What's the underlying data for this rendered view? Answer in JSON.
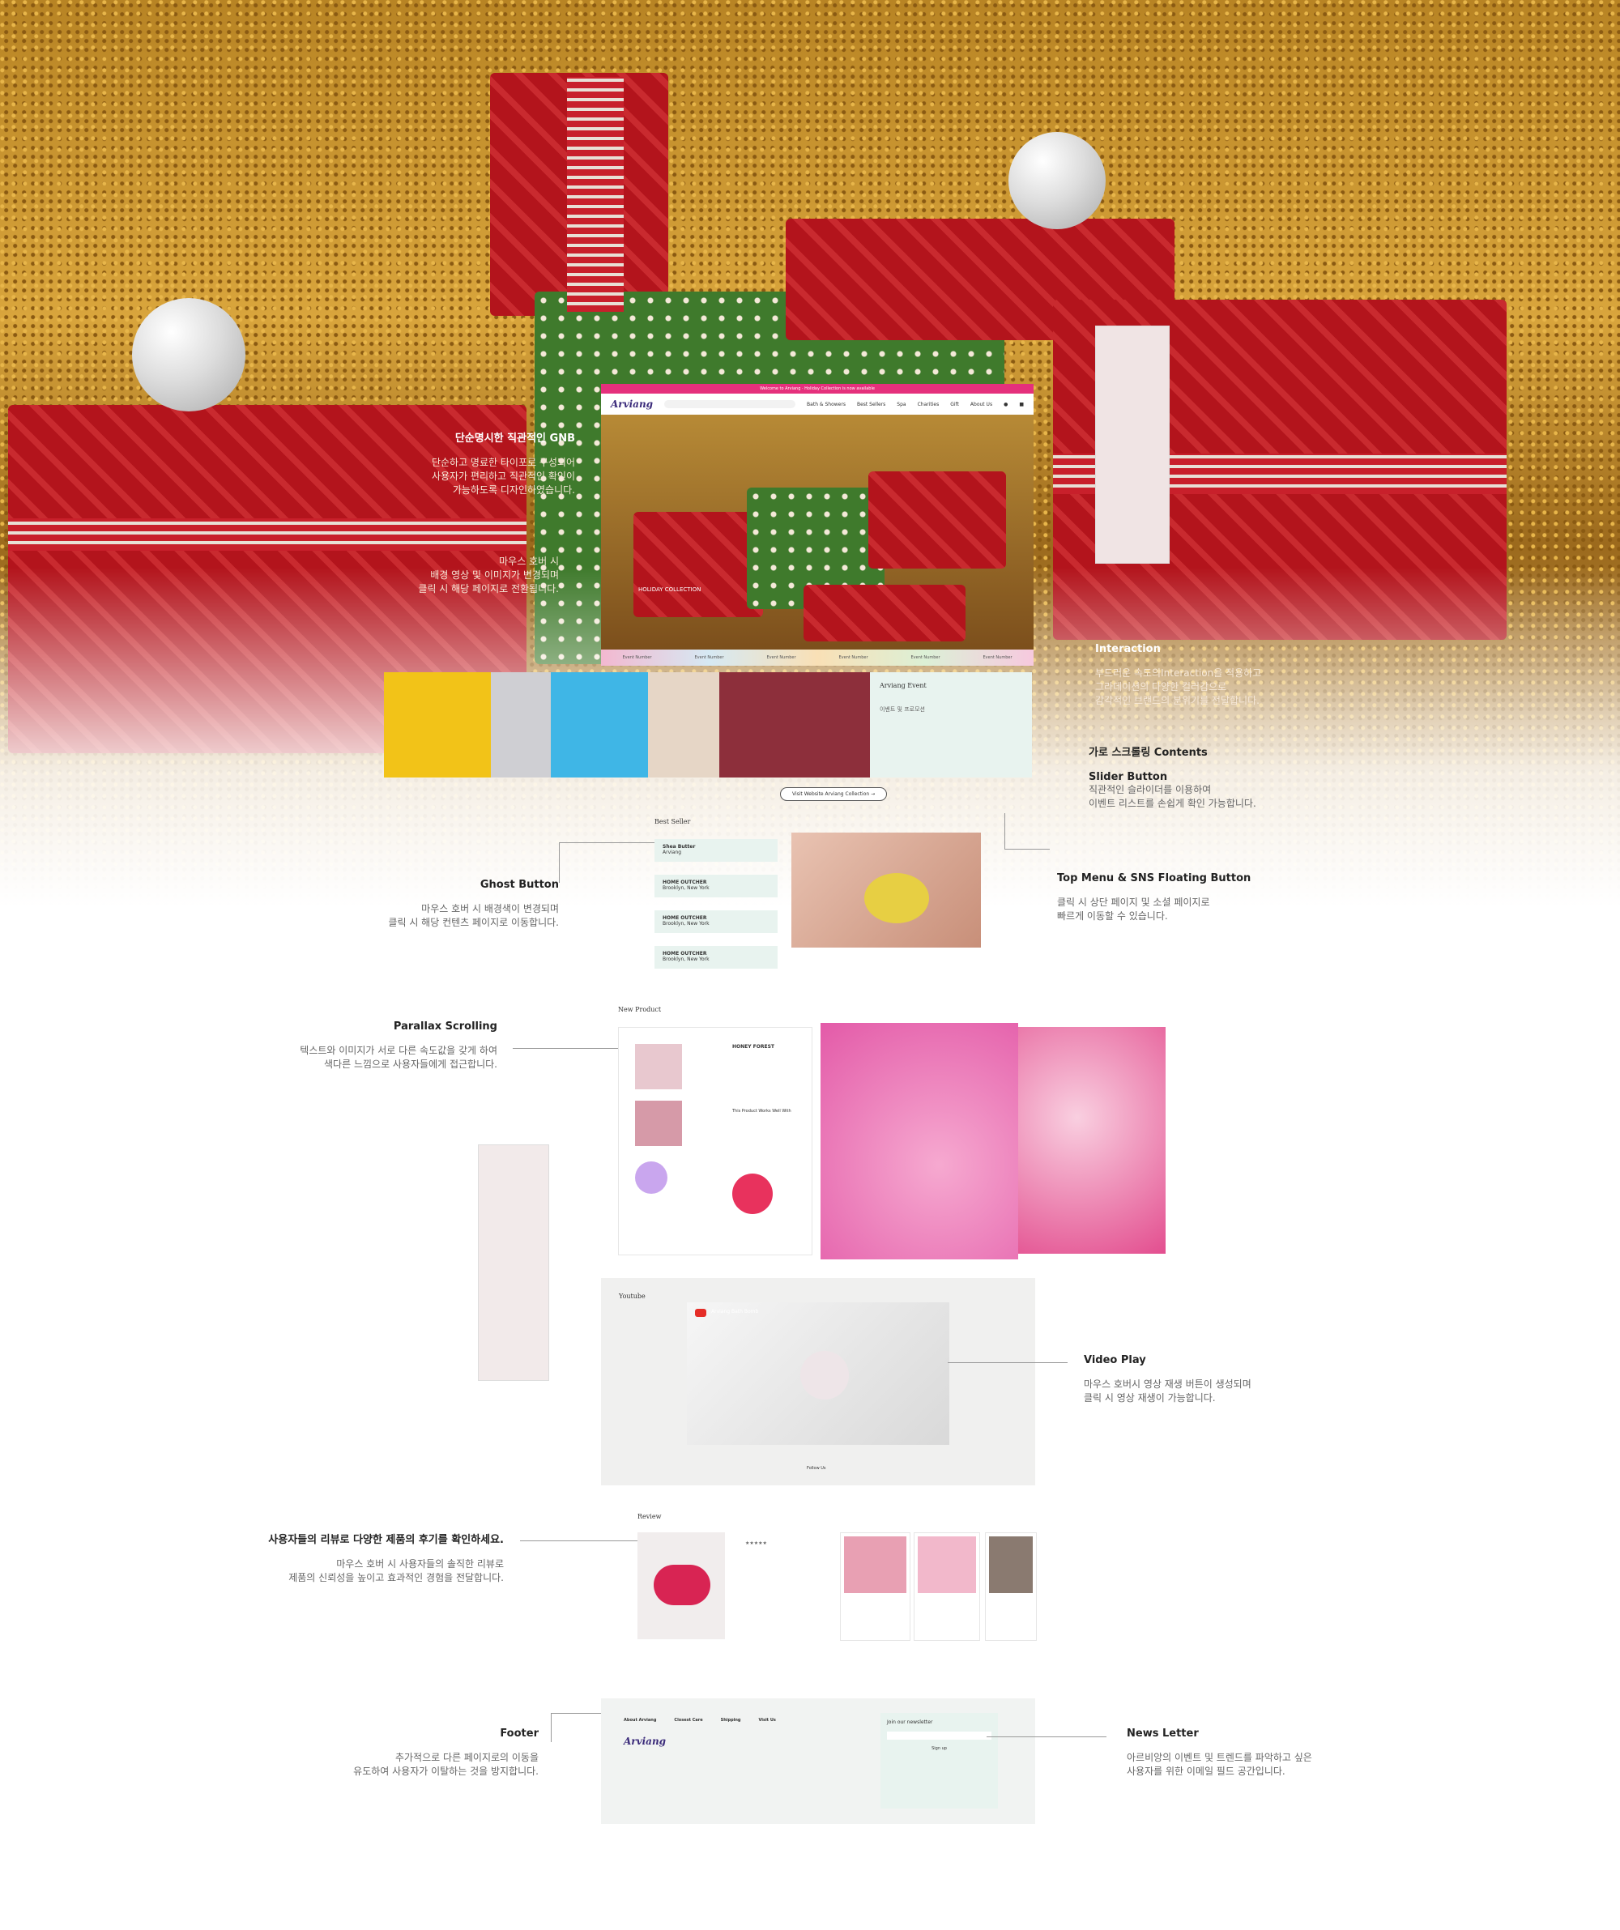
{
  "site": {
    "logo": "Arviang",
    "topbar": "Welcome to Arviang · Holiday Collection is now available",
    "menu": [
      "Bath & Showers",
      "Best Sellers",
      "Spa",
      "Charities",
      "Gift",
      "About Us"
    ],
    "hero_caption": "HOLIDAY COLLECTION",
    "event_title": "Arviang Event",
    "event_sub": "이벤트 및 프로모션",
    "ghost_button": "Visit Website Arviang Collection →",
    "best_seller": "Best Seller",
    "best_items": [
      {
        "name": "Shea Butter",
        "place": "Arviang"
      },
      {
        "name": "HOME OUTCHER",
        "place": "Brooklyn, New York"
      },
      {
        "name": "HOME OUTCHER",
        "place": "Brooklyn, New York"
      },
      {
        "name": "HOME OUTCHER",
        "place": "Brooklyn, New York"
      }
    ],
    "new_product": "New Product",
    "product_name": "HONEY FOREST",
    "product_works": "This Product Works Well With",
    "youtube": "Youtube",
    "video_title": "Arviang Bath Bomb",
    "follow": "Follow Us",
    "review": "Review",
    "review_stars": "★★★★★",
    "footer_cols": [
      "About Arviang",
      "Closest Care",
      "Shipping",
      "Visit Us"
    ],
    "newsletter_title": "Join our newsletter",
    "signup": "Sign up"
  },
  "annotations": {
    "gnb": {
      "title": "단순명시한 직관적인 GNB",
      "body": [
        "단순하고 명료한 타이포로 구성되어",
        "사용자가 편리하고 직관적인 확인이",
        "가능하도록 디자인하였습니다."
      ]
    },
    "hover": {
      "body": [
        "마우스 호버 시",
        "배경 영상 및 이미지가 변경되며",
        "클릭 시 해당 페이지로 전환됩니다."
      ]
    },
    "interaction": {
      "title": "Interaction",
      "body": [
        "부드러운 속도의Interaction을 적용하고",
        "그라데이션의 다양한 컬러감으로",
        "감각적인 브랜드의 분위기를 전달합니다."
      ]
    },
    "scroll": {
      "title": "가로 스크롤링 Contents"
    },
    "slider": {
      "title": "Slider Button",
      "body": [
        "직관적인 슬라이더를 이용하여",
        "이벤트 리스트를 손쉽게 확인 가능합니다."
      ]
    },
    "ghost": {
      "title": "Ghost Button",
      "body": [
        "마우스 호버 시 배경색이 변경되며",
        "클릭 시 해당 컨텐츠 페이지로 이동합니다."
      ]
    },
    "topmenu": {
      "title": "Top Menu & SNS Floating Button",
      "body": [
        "클릭 시 상단 페이지 및 소셜 페이지로",
        "빠르게 이동할 수 있습니다."
      ]
    },
    "parallax": {
      "title": "Parallax Scrolling",
      "body": [
        "텍스트와 이미지가 서로 다른 속도값을 갖게 하여",
        "색다른 느낌으로 사용자들에게 접근합니다."
      ]
    },
    "video": {
      "title": "Video Play",
      "body": [
        "마우스 호버시 영상 재생 버튼이 생성되며",
        "클릭 시 영상 재생이 가능합니다."
      ]
    },
    "review": {
      "title": "사용자들의 리뷰로 다양한 제품의 후기를 확인하세요.",
      "body": [
        "마우스 호버 시 사용자들의 솔직한 리뷰로",
        "제품의 신뢰성을 높이고 효과적인 경험을 전달합니다."
      ]
    },
    "footer": {
      "title": "Footer",
      "body": [
        "추가적으로 다른 페이지로의 이동을",
        "유도하여 사용자가 이탈하는 것을 방지합니다."
      ]
    },
    "newsletter": {
      "title": "News Letter",
      "body": [
        "아르비앙의 이벤트 및 트렌드를 파악하고 싶은",
        "사용자를 위한 이메일 필드 공간입니다."
      ]
    }
  },
  "colors": {
    "accent": "#e5307c",
    "mint": "#e8f3ef",
    "brand": "#3a2a7a"
  }
}
